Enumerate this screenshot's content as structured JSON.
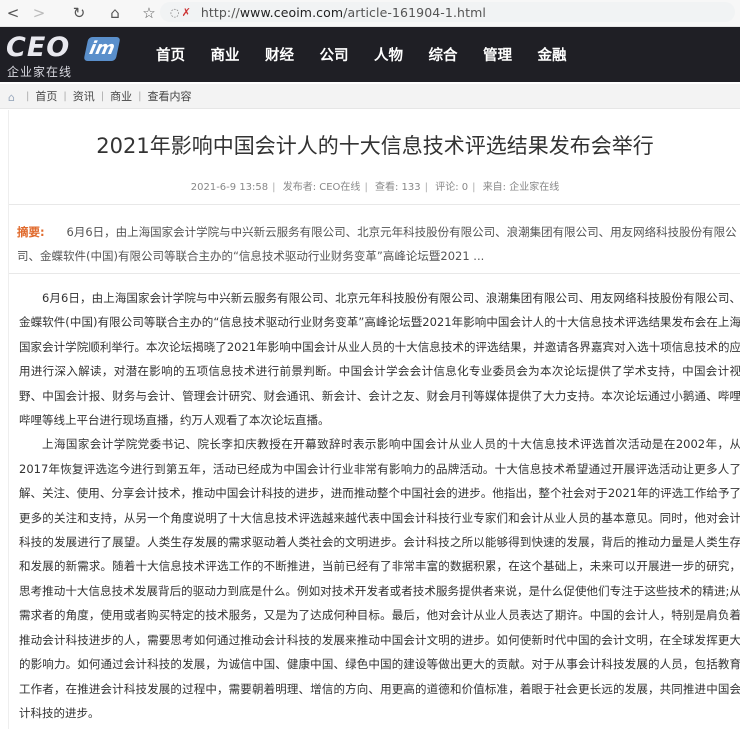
{
  "browser": {
    "back": "<",
    "reload": "↻",
    "home": "⌂",
    "star": "☆",
    "url_scheme": "http://",
    "url_host": "www.ceoim.com",
    "url_path": "/article-161904-1.html"
  },
  "site": {
    "logo_main": "CEO",
    "logo_badge": "im",
    "logo_sub": "企业家在线",
    "nav": [
      "首页",
      "商业",
      "财经",
      "公司",
      "人物",
      "综合",
      "管理",
      "金融"
    ]
  },
  "breadcrumb": [
    "首页",
    "资讯",
    "商业",
    "查看内容"
  ],
  "article": {
    "title": "2021年影响中国会计人的十大信息技术评选结果发布会举行",
    "meta": [
      "2021-6-9 13:58",
      "发布者: CEO在线",
      "查看: 133",
      "评论: 0",
      "来自: 企业家在线"
    ],
    "summary_label": "摘要:",
    "summary": "6月6日，由上海国家会计学院与中兴新云服务有限公司、北京元年科技股份有限公司、浪潮集团有限公司、用友网络科技股份有限公司、金蝶软件(中国)有限公司等联合主办的“信息技术驱动行业财务变革”高峰论坛暨2021 ...",
    "paragraphs": [
      "6月6日，由上海国家会计学院与中兴新云服务有限公司、北京元年科技股份有限公司、浪潮集团有限公司、用友网络科技股份有限公司、金蝶软件(中国)有限公司等联合主办的“信息技术驱动行业财务变革”高峰论坛暨2021年影响中国会计人的十大信息技术评选结果发布会在上海国家会计学院顺利举行。本次论坛揭晓了2021年影响中国会计从业人员的十大信息技术的评选结果，并邀请各界嘉宾对入选十项信息技术的应用进行深入解读，对潜在影响的五项信息技术进行前景判断。中国会计学会会计信息化专业委员会为本次论坛提供了学术支持，中国会计视野、中国会计报、财务与会计、管理会计研究、财会通讯、新会计、会计之友、财会月刊等媒体提供了大力支持。本次论坛通过小鹅通、哔哩哔哩等线上平台进行现场直播，约万人观看了本次论坛直播。",
      "上海国家会计学院党委书记、院长李扣庆教授在开幕致辞时表示影响中国会计从业人员的十大信息技术评选首次活动是在2002年，从2017年恢复评选迄今进行到第五年，活动已经成为中国会计行业非常有影响力的品牌活动。十大信息技术希望通过开展评选活动让更多人了解、关注、使用、分享会计技术，推动中国会计科技的进步，进而推动整个中国社会的进步。他指出，整个社会对于2021年的评选工作给予了更多的关注和支持，从另一个角度说明了十大信息技术评选越来越代表中国会计科技行业专家们和会计从业人员的基本意见。同时，他对会计科技的发展进行了展望。人类生存发展的需求驱动着人类社会的文明进步。会计科技之所以能够得到快速的发展，背后的推动力量是人类生存和发展的新需求。随着十大信息技术评选工作的不断推进，当前已经有了非常丰富的数据积累，在这个基础上，未来可以开展进一步的研究，思考推动十大信息技术发展背后的驱动力到底是什么。例如对技术开发者或者技术服务提供者来说，是什么促使他们专注于这些技术的精进;从需求者的角度，使用或者购买特定的技术服务，又是为了达成何种目标。最后，他对会计从业人员表达了期许。中国的会计人，特别是肩负着推动会计科技进步的人，需要思考如何通过推动会计科技的发展来推动中国会计文明的进步。如何使新时代中国的会计文明，在全球发挥更大的影响力。如何通过会计科技的发展，为诚信中国、健康中国、绿色中国的建设等做出更大的贡献。对于从事会计科技发展的人员，包括教育工作者，在推进会计科技发展的过程中，需要朝着明理、增信的方向、用更高的道德和价值标准，着眼于社会更长远的发展，共同推进中国会计科技的进步。"
    ]
  },
  "colors": {
    "header_bg": "#1f1f25",
    "logo_badge": "#5a8fcb",
    "summary_label": "#e06a2c"
  }
}
